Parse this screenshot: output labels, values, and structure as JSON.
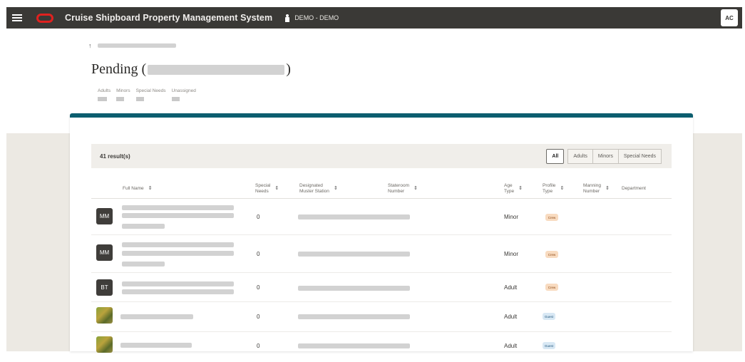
{
  "header": {
    "app_title": "Cruise Shipboard Property Management System",
    "environment": "DEMO - DEMO",
    "user_initials": "AC"
  },
  "page": {
    "title_prefix": "Pending (",
    "title_suffix": ")",
    "stats": [
      {
        "label": "Adults"
      },
      {
        "label": "Minors"
      },
      {
        "label": "Special Needs"
      },
      {
        "label": "Unassigned"
      }
    ]
  },
  "toolbar": {
    "results": "41 result(s)",
    "filters": [
      "All",
      "Adults",
      "Minors",
      "Special Needs"
    ],
    "active_filter": "All"
  },
  "table": {
    "columns": [
      {
        "line1": "Full Name",
        "line2": ""
      },
      {
        "line1": "Special",
        "line2": "Needs"
      },
      {
        "line1": "Designated",
        "line2": "Muster Station"
      },
      {
        "line1": "Stateroom",
        "line2": "Number"
      },
      {
        "line1": "Age",
        "line2": "Type"
      },
      {
        "line1": "Profile",
        "line2": "Type"
      },
      {
        "line1": "Manning",
        "line2": "Number"
      },
      {
        "line1": "Department",
        "line2": ""
      }
    ],
    "rows": [
      {
        "initials": "MM",
        "special_needs": "0",
        "age_type": "Minor",
        "profile_type": "Crew"
      },
      {
        "initials": "MM",
        "special_needs": "0",
        "age_type": "Minor",
        "profile_type": "Crew"
      },
      {
        "initials": "BT",
        "special_needs": "0",
        "age_type": "Adult",
        "profile_type": "Crew"
      },
      {
        "initials": "",
        "special_needs": "0",
        "age_type": "Adult",
        "profile_type": "Guest"
      },
      {
        "initials": "",
        "special_needs": "0",
        "age_type": "Adult",
        "profile_type": "Guest"
      }
    ]
  },
  "colors": {
    "topbar": "#3a3936",
    "accent": "#0c5e6f",
    "brand": "#e0211f"
  }
}
